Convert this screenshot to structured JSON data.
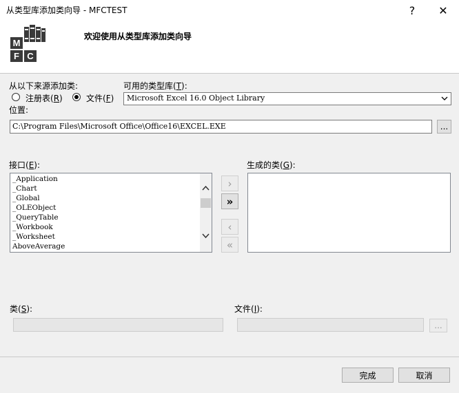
{
  "window": {
    "title": "从类型库添加类向导 - MFCTEST",
    "help_label": "?",
    "close_label": "✕"
  },
  "header": {
    "title": "欢迎使用从类型库添加类向导",
    "logo_letters": [
      "M",
      "F",
      "C"
    ]
  },
  "source": {
    "label": "从以下来源添加类:",
    "options": [
      {
        "label": "注册表(",
        "key": "R",
        "suffix": ")",
        "checked": false
      },
      {
        "label": "文件(",
        "key": "F",
        "suffix": ")",
        "checked": true
      }
    ]
  },
  "typelib": {
    "label": "可用的类型库(",
    "key": "T",
    "suffix": "):",
    "selected": "Microsoft Excel 16.0 Object Library"
  },
  "location": {
    "label": "位置:",
    "value": "C:\\Program Files\\Microsoft Office\\Office16\\EXCEL.EXE",
    "browse_label": "..."
  },
  "interfaces": {
    "label": "接口(",
    "key": "E",
    "suffix": "):",
    "items": [
      "_Application",
      "_Chart",
      "_Global",
      "_OLEObject",
      "_QueryTable",
      "_Workbook",
      "_Worksheet",
      "AboveAverage"
    ]
  },
  "transfer_buttons": {
    "add_one": "›",
    "add_all": "»",
    "remove_one": "‹",
    "remove_all": "«"
  },
  "generated": {
    "label": "生成的类(",
    "key": "G",
    "suffix": "):"
  },
  "class_field": {
    "label": "类(",
    "key": "S",
    "suffix": "):"
  },
  "file_field": {
    "label": "文件(",
    "key": "I",
    "suffix": "):",
    "browse_label": "..."
  },
  "footer": {
    "finish_label": "完成",
    "cancel_label": "取消"
  },
  "colors": {
    "window_bg": "#f0f0f0",
    "header_bg": "#ffffff",
    "logo_dark": "#3a3a3a"
  }
}
